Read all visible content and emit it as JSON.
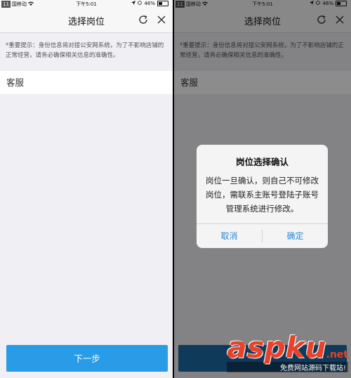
{
  "status_bar": {
    "badge": "11",
    "carrier": "国移动",
    "time": "下午5:01",
    "battery": "46%"
  },
  "nav": {
    "title": "选择岗位"
  },
  "notice": "*重要提示：身份信息将对接公安网系统，为了不影响店铺的正常经营，请务必确保相关信息的准确性。",
  "positions": [
    {
      "label": "客服"
    }
  ],
  "next_button": "下一步",
  "dialog": {
    "title": "岗位选择确认",
    "message": "岗位一旦确认，则自己不可修改岗位，需联系主账号登陆子账号管理系统进行修改。",
    "cancel": "取消",
    "confirm": "确定"
  },
  "watermark": {
    "logo": "aspku",
    "domain": ".net",
    "slogan": "免费网站源码下载站!"
  },
  "colors": {
    "primary": "#2a9be6",
    "link": "#2a8bd6",
    "background": "#efeff4",
    "watermark": "#e8422a"
  }
}
